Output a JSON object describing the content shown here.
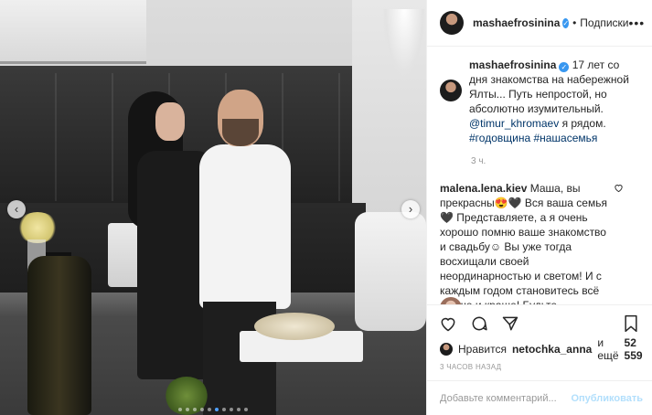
{
  "photo": {
    "prev_icon": "‹",
    "next_icon": "›",
    "dots_count": 10,
    "active_dot": 5
  },
  "header": {
    "username": "mashaefrosinina",
    "separator": "•",
    "follow_label": "Подписки",
    "more_icon": "•••"
  },
  "caption": {
    "username": "mashaefrosinina",
    "text_before_mention": "17 лет со дня знакомства на набережной Ялты... Путь непростой, но абсолютно изумительный.",
    "mention": "@timur_khromaev",
    "text_after_mention": "я рядом.",
    "hashtags": "#годовщина #нашасемья",
    "time": "3 ч."
  },
  "comment": {
    "username": "malena.lena.kiev",
    "text": "Маша, вы прекрасны😍🖤 Вся ваша семья 🖤 Представляете, а я очень хорошо помню ваше знакомство и свадьбу☺ Вы уже тогда восхищали своей неординарностью и светом! И с каждым годом становитесь всё лучше и краше! Будьте счастливы🖤 P.S. Помню, что в то время имя Тимур было..."
  },
  "likes": {
    "prefix": "Нравится",
    "user": "netochka_anna",
    "and_label": "и ещё",
    "count": "52 559"
  },
  "post_time": "3 ЧАСОВ НАЗАД",
  "add_comment": {
    "placeholder": "Добавьте комментарий...",
    "publish_label": "Опубликовать"
  },
  "colors": {
    "verified": "#3897f0",
    "publish_disabled": "#b2dffc",
    "link": "#003569"
  }
}
